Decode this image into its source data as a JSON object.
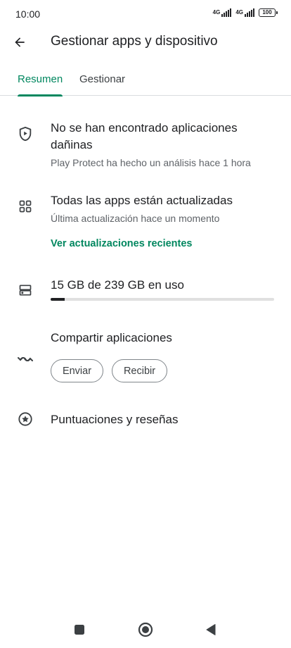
{
  "status_bar": {
    "time": "10:00",
    "network_1": "4G",
    "network_2": "4G",
    "battery": "100"
  },
  "header": {
    "title": "Gestionar apps y dispositivo",
    "back_icon": "arrow-back-icon"
  },
  "tabs": [
    {
      "label": "Resumen",
      "active": true
    },
    {
      "label": "Gestionar",
      "active": false
    }
  ],
  "protect": {
    "icon": "shield-play-icon",
    "title": "No se han encontrado aplicaciones dañinas",
    "subtitle": "Play Protect ha hecho un análisis hace 1 hora"
  },
  "updates": {
    "icon": "apps-grid-icon",
    "title": "Todas las apps están actualizadas",
    "subtitle": "Última actualización hace un momento",
    "link": "Ver actualizaciones recientes"
  },
  "storage": {
    "icon": "storage-icon",
    "title": "15 GB de 239 GB en uso",
    "used_fraction": 0.063
  },
  "share": {
    "icon": "nearby-share-icon",
    "title": "Compartir aplicaciones",
    "send_label": "Enviar",
    "receive_label": "Recibir"
  },
  "ratings": {
    "icon": "star-circle-icon",
    "title": "Puntuaciones y reseñas"
  },
  "colors": {
    "accent": "#01875f",
    "text_primary": "#202124",
    "text_secondary": "#5f6368"
  },
  "nav_bar": {
    "recents_icon": "square-icon",
    "home_icon": "circle-icon",
    "back_icon": "triangle-back-icon"
  }
}
